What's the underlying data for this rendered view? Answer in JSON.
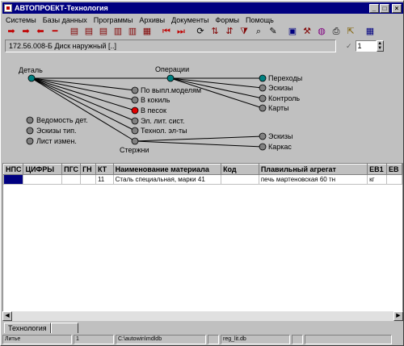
{
  "window": {
    "title": "АВТОПРОЕКТ-Технология",
    "min": "_",
    "max": "□",
    "close": "×"
  },
  "menu": [
    "Системы",
    "Базы данных",
    "Программы",
    "Архивы",
    "Документы",
    "Формы",
    "Помощь"
  ],
  "toolbar": [
    "arrow-right-icon",
    "arrow-right-icon",
    "arrow-left-icon",
    "minus-icon",
    "new-doc-icon",
    "copy-doc-icon",
    "copy-doc-icon",
    "insert-icon",
    "insert-icon",
    "delete-icon",
    "first-record-icon",
    "last-record-icon",
    "refresh-icon",
    "sort-icon",
    "sort-icon",
    "filter-icon",
    "find-icon",
    "edit-icon",
    "save-icon",
    "tools-icon",
    "globe-icon",
    "print-icon",
    "exit-icon",
    "calculator-icon"
  ],
  "address": {
    "path": "172.56.008-Б Диск наружный [..]",
    "page": "1",
    "check": "✓"
  },
  "tree": {
    "root": "Деталь",
    "ops": "Операции",
    "rods": "Стержни",
    "ops_children": [
      "Переходы",
      "Эскизы",
      "Контроль",
      "Карты"
    ],
    "materials": [
      "По выпл.моделям",
      "В кокиль",
      "В песок",
      "Эл. лит. сист.",
      "Технол. эл-ты"
    ],
    "left_items": [
      "Ведомость дет.",
      "Эскизы тип.",
      "Лист измен."
    ],
    "rods_children": [
      "Эскизы",
      "Каркас"
    ]
  },
  "table": {
    "headers": [
      "НПС",
      "ЦИФРЫ",
      "ПГС",
      "ГН",
      "КТ",
      "Наименование материала",
      "Код",
      "Плавильный агрегат",
      "ЕВ1",
      "ЕВ"
    ],
    "rows": [
      [
        "",
        "",
        "",
        "",
        "11",
        "Сталь специальная, марки 41",
        "",
        "печь мартеновская 60 тн",
        "кг",
        ""
      ]
    ]
  },
  "tabs": [
    "Технология",
    ""
  ],
  "status": [
    "Литье",
    "1",
    "C:\\autowin\\mdldb",
    "",
    "reg_lit.db",
    "",
    ""
  ],
  "colors": {
    "title": "#000080",
    "node_teal": "#008080",
    "node_gray": "#808080",
    "node_red": "#e00000"
  }
}
